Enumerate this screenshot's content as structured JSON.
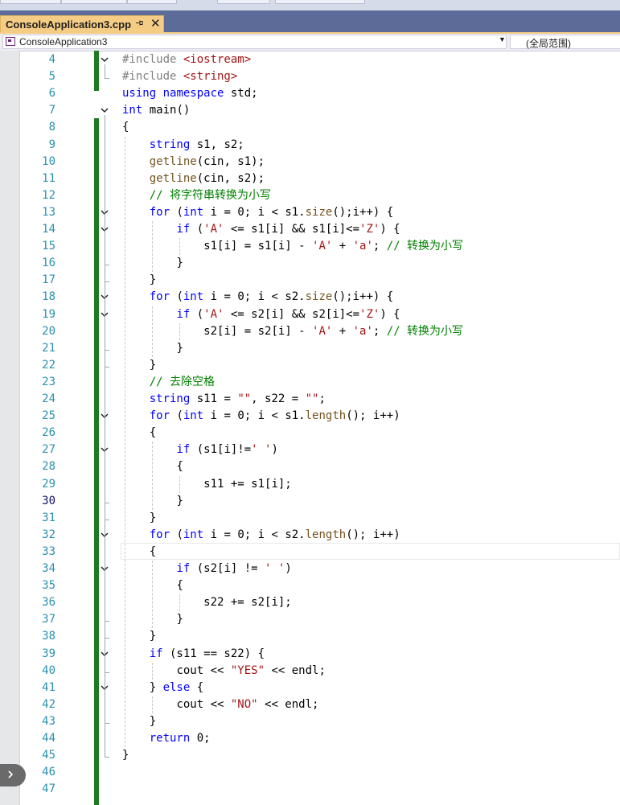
{
  "window": {
    "tab_title": "ConsoleApplication3.cpp",
    "tab_pin_icon": "pin-icon",
    "tab_close_glyph": "✕"
  },
  "navbar": {
    "project": "ConsoleApplication3",
    "scope": "(全局范围)"
  },
  "editor": {
    "current_line": 30,
    "lines": [
      {
        "n": "4"
      },
      {
        "n": "5"
      },
      {
        "n": "6"
      },
      {
        "n": "7"
      },
      {
        "n": "8"
      },
      {
        "n": "9"
      },
      {
        "n": "10"
      },
      {
        "n": "11"
      },
      {
        "n": "12"
      },
      {
        "n": "13"
      },
      {
        "n": "14"
      },
      {
        "n": "15"
      },
      {
        "n": "16"
      },
      {
        "n": "17"
      },
      {
        "n": "18"
      },
      {
        "n": "19"
      },
      {
        "n": "20"
      },
      {
        "n": "21"
      },
      {
        "n": "22"
      },
      {
        "n": "23"
      },
      {
        "n": "24"
      },
      {
        "n": "25"
      },
      {
        "n": "26"
      },
      {
        "n": "27"
      },
      {
        "n": "28"
      },
      {
        "n": "29"
      },
      {
        "n": "30"
      },
      {
        "n": "31"
      },
      {
        "n": "32"
      },
      {
        "n": "33"
      },
      {
        "n": "34"
      },
      {
        "n": "35"
      },
      {
        "n": "36"
      },
      {
        "n": "37"
      },
      {
        "n": "38"
      },
      {
        "n": "39"
      },
      {
        "n": "40"
      },
      {
        "n": "41"
      },
      {
        "n": "42"
      },
      {
        "n": "43"
      },
      {
        "n": "44"
      },
      {
        "n": "45"
      },
      {
        "n": "46"
      },
      {
        "n": "47"
      }
    ],
    "code": {
      "l4": [
        "#include ",
        "<iostream>"
      ],
      "l5": [
        "#include ",
        "<string>"
      ],
      "l6": [
        "using",
        " ",
        "namespace",
        " std;"
      ],
      "l7": [
        "int",
        " main()"
      ],
      "l8": [
        "{"
      ],
      "l9": [
        "    ",
        "string",
        " s1, s2;"
      ],
      "l10": [
        "    ",
        "getline",
        "(cin, s1);"
      ],
      "l11": [
        "    ",
        "getline",
        "(cin, s2);"
      ],
      "l12": [
        "    ",
        "// 将字符串转换为小写"
      ],
      "l13": [
        "    ",
        "for",
        " (",
        "int",
        " i = 0; i < s1.",
        "size",
        "();i++) {"
      ],
      "l14": [
        "        ",
        "if",
        " (",
        "'A'",
        " <= s1[i] && s1[i]<=",
        "'Z'",
        ") {"
      ],
      "l15": [
        "            ",
        "s1[i] = s1[i] - ",
        "'A'",
        " + ",
        "'a'",
        "; ",
        "// 转换为小写"
      ],
      "l16": [
        "        ",
        "}"
      ],
      "l17": [
        "    ",
        "}"
      ],
      "l18": [
        "    ",
        "for",
        " (",
        "int",
        " i = 0; i < s2.",
        "size",
        "();i++) {"
      ],
      "l19": [
        "        ",
        "if",
        " (",
        "'A'",
        " <= s2[i] && s2[i]<=",
        "'Z'",
        ") {"
      ],
      "l20": [
        "            ",
        "s2[i] = s2[i] - ",
        "'A'",
        " + ",
        "'a'",
        "; ",
        "// 转换为小写"
      ],
      "l21": [
        "        ",
        "}"
      ],
      "l22": [
        "    ",
        "}"
      ],
      "l23": [
        "    ",
        "// 去除空格"
      ],
      "l24": [
        "    ",
        "string",
        " s11 = ",
        "\"\"",
        ", s22 = ",
        "\"\"",
        ";"
      ],
      "l25": [
        "    ",
        "for",
        " (",
        "int",
        " i = 0; i < s1.",
        "length",
        "(); i++)"
      ],
      "l26": [
        "    ",
        "{"
      ],
      "l27": [
        "        ",
        "if",
        " (s1[i]!=",
        "' '",
        ")"
      ],
      "l28": [
        "        ",
        "{"
      ],
      "l29": [
        "            ",
        "s11 += s1[i];"
      ],
      "l30": [
        "        ",
        "}"
      ],
      "l31": [
        "    ",
        "}"
      ],
      "l32": [
        "    ",
        "for",
        " (",
        "int",
        " i = 0; i < s2.",
        "length",
        "(); i++)"
      ],
      "l33": [
        "    ",
        "{"
      ],
      "l34": [
        "        ",
        "if",
        " (s2[i] != ",
        "' '",
        ")"
      ],
      "l35": [
        "        ",
        "{"
      ],
      "l36": [
        "            ",
        "s22 += s2[i];"
      ],
      "l37": [
        "        ",
        "}"
      ],
      "l38": [
        "    ",
        "}"
      ],
      "l39": [
        "    ",
        "if",
        " (s11 == s22) {"
      ],
      "l40": [
        "        ",
        "cout << ",
        "\"YES\"",
        " << endl;"
      ],
      "l41": [
        "    ",
        "} ",
        "else",
        " {"
      ],
      "l42": [
        "        ",
        "cout << ",
        "\"NO\"",
        " << endl;"
      ],
      "l43": [
        "    ",
        "}"
      ],
      "l44": [
        "    ",
        "return",
        " 0;"
      ],
      "l45": [
        "}"
      ],
      "l46": [
        ""
      ],
      "l47": [
        ""
      ]
    }
  },
  "colors": {
    "keyword": "#0000ff",
    "preprocessor": "#808080",
    "string": "#a31515",
    "comment": "#008000",
    "line_number": "#2b91af",
    "change_bar": "#1e7b22",
    "tab_active": "#f5cc84"
  }
}
